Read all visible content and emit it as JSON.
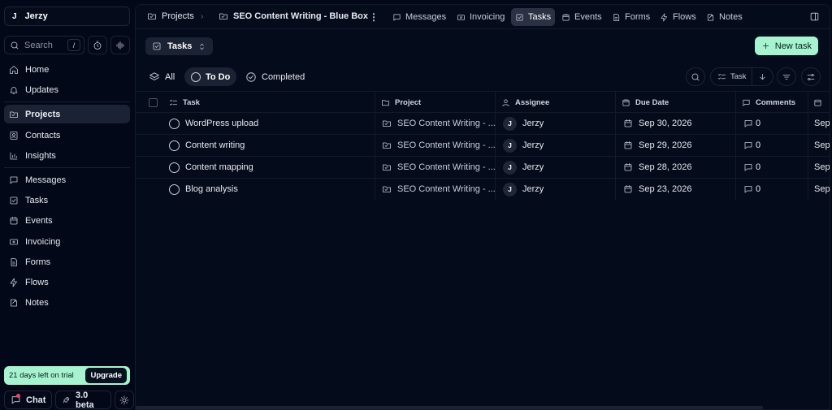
{
  "workspace": {
    "initial": "J",
    "name": "Jerzy"
  },
  "search": {
    "placeholder": "Search",
    "shortcut": "/"
  },
  "nav": {
    "primary": [
      {
        "label": "Home",
        "icon": "home-icon"
      },
      {
        "label": "Updates",
        "icon": "bell-icon"
      }
    ],
    "workspace": [
      {
        "label": "Projects",
        "icon": "folder-icon",
        "active": true
      },
      {
        "label": "Contacts",
        "icon": "contact-icon"
      },
      {
        "label": "Insights",
        "icon": "bar-chart-icon"
      }
    ],
    "apps": [
      {
        "label": "Messages",
        "icon": "message-icon"
      },
      {
        "label": "Tasks",
        "icon": "check-square-icon"
      },
      {
        "label": "Events",
        "icon": "calendar-icon"
      },
      {
        "label": "Invoicing",
        "icon": "invoice-icon"
      },
      {
        "label": "Forms",
        "icon": "form-icon"
      },
      {
        "label": "Flows",
        "icon": "bolt-icon"
      },
      {
        "label": "Notes",
        "icon": "note-icon"
      }
    ]
  },
  "trial": {
    "text": "21 days left on trial",
    "button": "Upgrade"
  },
  "bottom": {
    "chat": "Chat",
    "version": "3.0 beta"
  },
  "breadcrumb": {
    "root": "Projects",
    "project": "SEO Content Writing - Blue Box"
  },
  "tabs": [
    {
      "label": "Messages",
      "icon": "message-icon"
    },
    {
      "label": "Invoicing",
      "icon": "invoice-icon"
    },
    {
      "label": "Tasks",
      "icon": "check-square-icon",
      "active": true
    },
    {
      "label": "Events",
      "icon": "calendar-icon"
    },
    {
      "label": "Forms",
      "icon": "form-icon"
    },
    {
      "label": "Flows",
      "icon": "bolt-icon"
    },
    {
      "label": "Notes",
      "icon": "note-icon"
    }
  ],
  "toolbar": {
    "view_label": "Tasks",
    "new_task_label": "New task",
    "sort_label": "Task"
  },
  "filters": [
    {
      "label": "All",
      "active": false
    },
    {
      "label": "To Do",
      "active": true
    },
    {
      "label": "Completed",
      "active": false
    }
  ],
  "table": {
    "columns": [
      "Task",
      "Project",
      "Assignee",
      "Due Date",
      "Comments"
    ],
    "rows": [
      {
        "task": "WordPress upload",
        "project": "SEO Content Writing - ...",
        "assignee_initial": "J",
        "assignee": "Jerzy",
        "due": "Sep 30, 2026",
        "comments": "0",
        "extra": "Sep"
      },
      {
        "task": "Content writing",
        "project": "SEO Content Writing - ...",
        "assignee_initial": "J",
        "assignee": "Jerzy",
        "due": "Sep 29, 2026",
        "comments": "0",
        "extra": "Sep"
      },
      {
        "task": "Content mapping",
        "project": "SEO Content Writing - ...",
        "assignee_initial": "J",
        "assignee": "Jerzy",
        "due": "Sep 28, 2026",
        "comments": "0",
        "extra": "Sep"
      },
      {
        "task": "Blog analysis",
        "project": "SEO Content Writing - ...",
        "assignee_initial": "J",
        "assignee": "Jerzy",
        "due": "Sep 23, 2026",
        "comments": "0",
        "extra": "Sep"
      }
    ]
  },
  "colors": {
    "accent": "#a7f3d0",
    "background": "#020817",
    "active": "#1b2233"
  }
}
